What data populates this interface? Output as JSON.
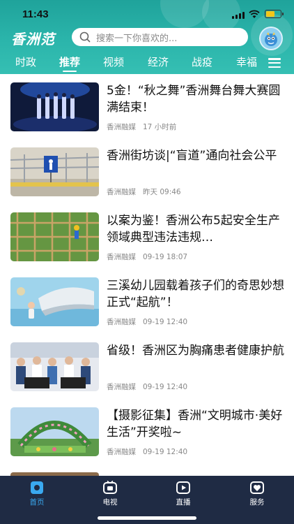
{
  "status_bar": {
    "time": "11:43"
  },
  "header": {
    "logo": "香洲范",
    "search_placeholder": "搜索一下你喜欢的...",
    "avatar_icon": "mascot-avatar-icon",
    "accent_color": "#2bb5ab"
  },
  "tabs": [
    {
      "label": "时政"
    },
    {
      "label": "推荐",
      "active": true
    },
    {
      "label": "视频"
    },
    {
      "label": "经济"
    },
    {
      "label": "战疫"
    },
    {
      "label": "幸福"
    }
  ],
  "news": [
    {
      "title": "5金！“秋之舞”香洲舞台舞大赛圆满结束！",
      "source": "香洲融媒",
      "time": "17 小时前"
    },
    {
      "title": "香洲街坊谈|“盲道”通向社会公平",
      "source": "香洲融媒",
      "time": "昨天 09:46"
    },
    {
      "title": "以案为鉴！香洲公布5起安全生产领域典型违法违规…",
      "source": "香洲融媒",
      "time": "09-19 18:07"
    },
    {
      "title": "三溪幼儿园载着孩子们的奇思妙想正式“起航”！",
      "source": "香洲融媒",
      "time": "09-19 12:40"
    },
    {
      "title": "省级！香洲区为胸痛患者健康护航",
      "source": "香洲融媒",
      "time": "09-19 12:40"
    },
    {
      "title": "【摄影征集】香洲“文明城市·美好生活”开奖啦~",
      "source": "香洲融媒",
      "time": "09-19 12:40"
    }
  ],
  "tabbar": [
    {
      "label": "首页",
      "icon": "home-icon",
      "active": true
    },
    {
      "label": "电视",
      "icon": "tv-icon"
    },
    {
      "label": "直播",
      "icon": "live-icon"
    },
    {
      "label": "服务",
      "icon": "service-icon"
    }
  ],
  "colors": {
    "tabbar_bg": "#1f2b44",
    "tabbar_active": "#3aa9f0"
  }
}
